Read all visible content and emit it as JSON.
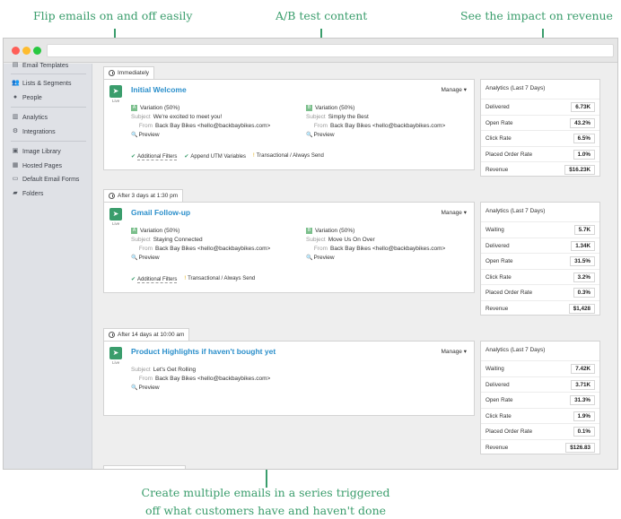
{
  "callouts": {
    "flip": "Flip emails on and off easily",
    "ab": "A/B test content",
    "impact": "See the impact on revenue",
    "bottom_line1": "Create multiple emails in a series triggered",
    "bottom_line2": "off what customers have and haven't done"
  },
  "colors": {
    "accent_green": "#3a9d6c",
    "title_blue": "#2b8fcb"
  },
  "sidebar": {
    "items": [
      {
        "label": "Email Templates",
        "icon": "template-icon"
      },
      {
        "label": "Lists & Segments",
        "icon": "users-icon"
      },
      {
        "label": "People",
        "icon": "person-icon"
      },
      {
        "label": "Analytics",
        "icon": "bar-chart-icon"
      },
      {
        "label": "Integrations",
        "icon": "gear-icon"
      },
      {
        "label": "Image Library",
        "icon": "image-icon"
      },
      {
        "label": "Hosted Pages",
        "icon": "page-icon"
      },
      {
        "label": "Default Email Forms",
        "icon": "form-icon"
      },
      {
        "label": "Folders",
        "icon": "folder-icon"
      }
    ]
  },
  "emails": [
    {
      "trigger": "Immediately",
      "status": "Live",
      "title": "Initial Welcome",
      "manage": "Manage ▾",
      "variations": [
        {
          "badge": "A",
          "label": "Variation (50%)",
          "subject_label": "Subject",
          "subject": "We're excited to meet you!",
          "from_label": "From",
          "from": "Back Bay Bikes <hello@backbaybikes.com>",
          "preview": "Preview"
        },
        {
          "badge": "B",
          "label": "Variation (50%)",
          "subject_label": "Subject",
          "subject": "Simply the Best",
          "from_label": "From",
          "from": "Back Bay Bikes <hello@backbaybikes.com>",
          "preview": "Preview"
        }
      ],
      "filters": [
        "Additional Filters",
        "Append UTM Variables",
        "Transactional / Always Send"
      ],
      "analytics": {
        "title": "Analytics (Last 7 Days)",
        "rows": [
          {
            "label": "Delivered",
            "value": "6.73K"
          },
          {
            "label": "Open Rate",
            "value": "43.2%"
          },
          {
            "label": "Click Rate",
            "value": "6.5%"
          },
          {
            "label": "Placed Order Rate",
            "value": "1.0%"
          },
          {
            "label": "Revenue",
            "value": "$16.23K"
          }
        ]
      }
    },
    {
      "trigger": "After 3 days at 1:30 pm",
      "status": "Live",
      "title": "Gmail Follow-up",
      "manage": "Manage ▾",
      "variations": [
        {
          "badge": "A",
          "label": "Variation (50%)",
          "subject_label": "Subject",
          "subject": "Staying Connected",
          "from_label": "From",
          "from": "Back Bay Bikes <hello@backbaybikes.com>",
          "preview": "Preview"
        },
        {
          "badge": "B",
          "label": "Variation (50%)",
          "subject_label": "Subject",
          "subject": "Move Us On Over",
          "from_label": "From",
          "from": "Back Bay Bikes <hello@backbaybikes.com>",
          "preview": "Preview"
        }
      ],
      "filters": [
        "Additional Filters",
        "Transactional / Always Send"
      ],
      "analytics": {
        "title": "Analytics (Last 7 Days)",
        "rows": [
          {
            "label": "Waiting",
            "value": "5.7K"
          },
          {
            "label": "Delivered",
            "value": "1.34K"
          },
          {
            "label": "Open Rate",
            "value": "31.5%"
          },
          {
            "label": "Click Rate",
            "value": "3.2%"
          },
          {
            "label": "Placed Order Rate",
            "value": "0.3%"
          },
          {
            "label": "Revenue",
            "value": "$1,428"
          }
        ]
      }
    },
    {
      "trigger": "After 14 days at 10:00 am",
      "status": "Live",
      "title": "Product Highlights if haven't bought yet",
      "manage": "Manage ▾",
      "single": {
        "subject_label": "Subject",
        "subject": "Let's Get Rolling",
        "from_label": "From",
        "from": "Back Bay Bikes <hello@backbaybikes.com>",
        "preview": "Preview"
      },
      "analytics": {
        "title": "Analytics (Last 7 Days)",
        "rows": [
          {
            "label": "Waiting",
            "value": "7.42K"
          },
          {
            "label": "Delivered",
            "value": "3.71K"
          },
          {
            "label": "Open Rate",
            "value": "31.3%"
          },
          {
            "label": "Click Rate",
            "value": "1.9%"
          },
          {
            "label": "Placed Order Rate",
            "value": "0.1%"
          },
          {
            "label": "Revenue",
            "value": "$126.83"
          }
        ]
      }
    }
  ]
}
